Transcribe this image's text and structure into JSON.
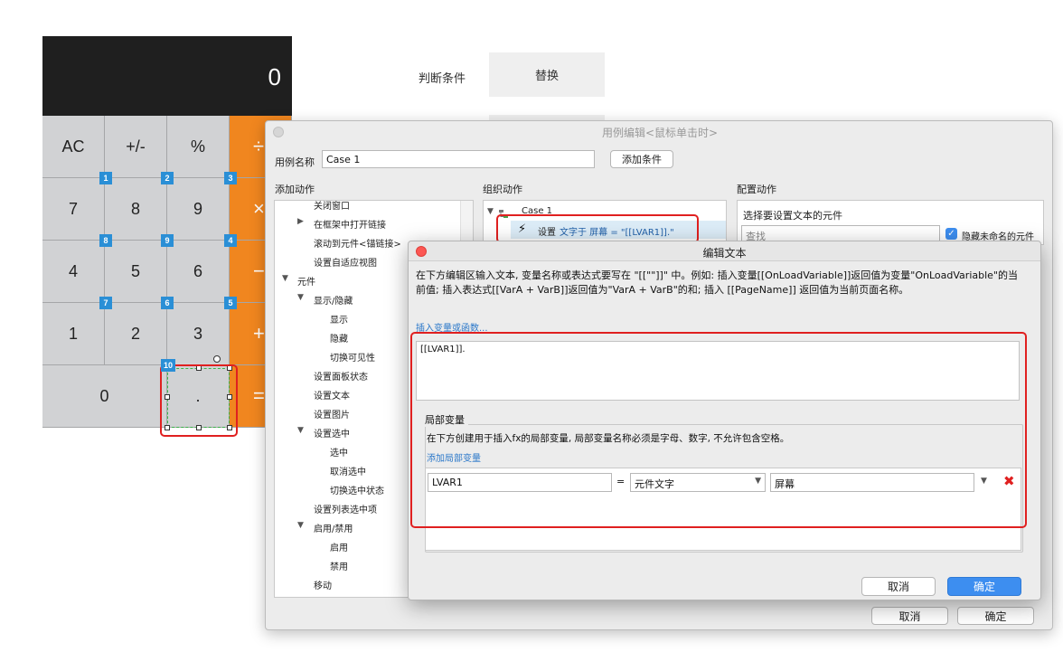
{
  "calculator": {
    "display": "0",
    "keys": [
      {
        "label": "AC"
      },
      {
        "label": "+/-"
      },
      {
        "label": "%"
      },
      {
        "label": "÷"
      },
      {
        "label": "7"
      },
      {
        "label": "8"
      },
      {
        "label": "9"
      },
      {
        "label": "×"
      },
      {
        "label": "4"
      },
      {
        "label": "5"
      },
      {
        "label": "6"
      },
      {
        "label": "−"
      },
      {
        "label": "1"
      },
      {
        "label": "2"
      },
      {
        "label": "3"
      },
      {
        "label": "+"
      },
      {
        "label": "0"
      },
      {
        "label": "."
      },
      {
        "label": "="
      }
    ],
    "badges": [
      "1",
      "2",
      "3",
      "8",
      "9",
      "4",
      "7",
      "6",
      "5",
      "10"
    ]
  },
  "right_panel": {
    "condition_label": "判断条件",
    "replace_button": "替换"
  },
  "case_dialog": {
    "title": "用例编辑<鼠标单击时>",
    "case_name_label": "用例名称",
    "case_name_value": "Case 1",
    "add_condition_button": "添加条件",
    "add_action_header": "添加动作",
    "organize_action_header": "组织动作",
    "configure_action_header": "配置动作",
    "actions_tree": [
      "关闭窗口",
      "在框架中打开链接",
      "滚动到元件<锚链接>",
      "设置自适应视图",
      "元件",
      "显示/隐藏",
      "显示",
      "隐藏",
      "切换可见性",
      "设置面板状态",
      "设置文本",
      "设置图片",
      "设置选中",
      "选中",
      "取消选中",
      "切换选中状态",
      "设置列表选中项",
      "启用/禁用",
      "启用",
      "禁用",
      "移动"
    ],
    "organize_case": "Case 1",
    "organize_action_prefix": "设置",
    "organize_action_detail": "文字于 屏幕 = \"[[LVAR1]].\"",
    "configure_subheader": "选择要设置文本的元件",
    "search_placeholder": "查找",
    "hide_unnamed_label": "隐藏未命名的元件",
    "cancel_button": "取消",
    "ok_button": "确定"
  },
  "edit_dialog": {
    "title": "编辑文本",
    "description": "在下方编辑区输入文本, 变量名称或表达式要写在 \"[[\"\"]]\" 中。例如: 插入变量[[OnLoadVariable]]返回值为变量\"OnLoadVariable\"的当前值; 插入表达式[[VarA + VarB]]返回值为\"VarA + VarB\"的和; 插入 [[PageName]] 返回值为当前页面名称。",
    "insert_link": "插入变量或函数...",
    "text_value": "[[LVAR1]].",
    "local_vars_legend": "局部变量",
    "local_vars_desc": "在下方创建用于插入fx的局部变量, 局部变量名称必须是字母、数字, 不允许包含空格。",
    "add_local_var_link": "添加局部变量",
    "var_name": "LVAR1",
    "equals": "=",
    "var_type": "元件文字",
    "var_target": "屏幕",
    "cancel_button": "取消",
    "ok_button": "确定"
  },
  "colors": {
    "accent_orange": "#f0861f",
    "badge_blue": "#2a8fd6",
    "highlight_red": "#e02020",
    "primary_blue": "#3d8ef0"
  }
}
